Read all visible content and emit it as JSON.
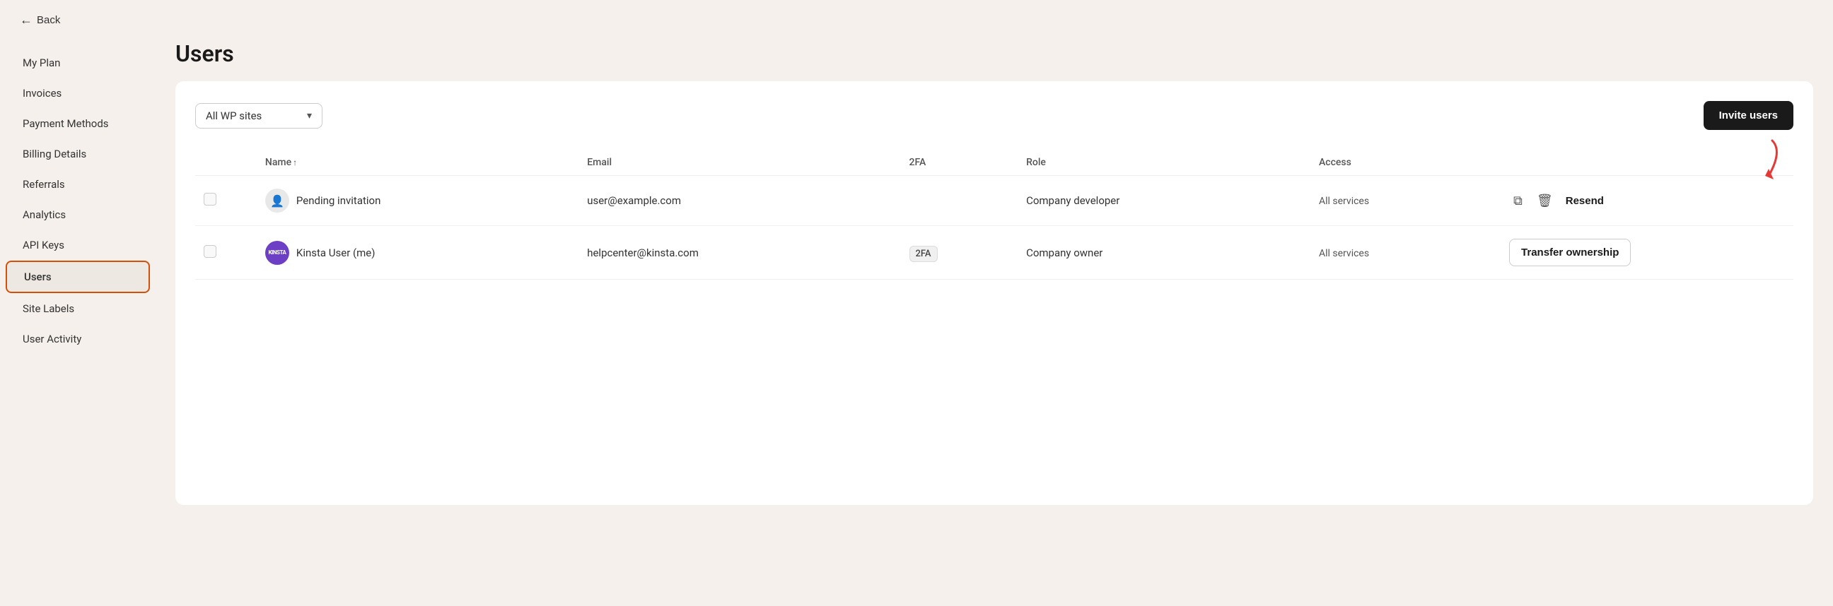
{
  "topBar": {
    "backLabel": "Back"
  },
  "sidebar": {
    "items": [
      {
        "id": "my-plan",
        "label": "My Plan",
        "active": false
      },
      {
        "id": "invoices",
        "label": "Invoices",
        "active": false
      },
      {
        "id": "payment-methods",
        "label": "Payment Methods",
        "active": false
      },
      {
        "id": "billing-details",
        "label": "Billing Details",
        "active": false
      },
      {
        "id": "referrals",
        "label": "Referrals",
        "active": false
      },
      {
        "id": "analytics",
        "label": "Analytics",
        "active": false
      },
      {
        "id": "api-keys",
        "label": "API Keys",
        "active": false
      },
      {
        "id": "users",
        "label": "Users",
        "active": true
      },
      {
        "id": "site-labels",
        "label": "Site Labels",
        "active": false
      },
      {
        "id": "user-activity",
        "label": "User Activity",
        "active": false
      }
    ]
  },
  "page": {
    "title": "Users"
  },
  "toolbar": {
    "filterLabel": "All WP sites",
    "inviteButtonLabel": "Invite users"
  },
  "table": {
    "columns": {
      "name": "Name",
      "sortIcon": "↑",
      "email": "Email",
      "twofa": "2FA",
      "role": "Role",
      "access": "Access"
    },
    "rows": [
      {
        "id": "pending",
        "avatarType": "pending",
        "avatarText": "👤",
        "name": "Pending invitation",
        "email": "user@example.com",
        "twofa": "",
        "role": "Company developer",
        "access": "All services",
        "actionType": "resend",
        "resendLabel": "Resend",
        "copyIcon": "⧉",
        "deleteIcon": "🗑"
      },
      {
        "id": "kinsta-user",
        "avatarType": "kinsta",
        "avatarText": "KINSTA",
        "name": "Kinsta User (me)",
        "email": "helpcenter@kinsta.com",
        "twofa": "2FA",
        "role": "Company owner",
        "access": "All services",
        "actionType": "transfer",
        "transferLabel": "Transfer ownership"
      }
    ]
  },
  "arrowAnnotation": {
    "visible": true
  }
}
